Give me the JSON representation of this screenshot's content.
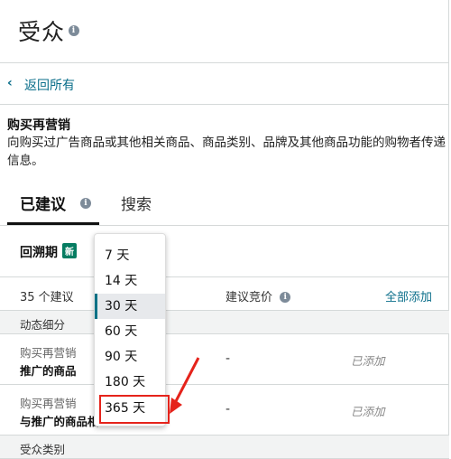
{
  "header": {
    "title": "受众"
  },
  "back_link": {
    "label": "返回所有"
  },
  "description": {
    "title": "购买再营销",
    "body": "向购买过广告商品或其他相关商品、商品类别、品牌及其他商品功能的购物者传递信息。"
  },
  "tabs": [
    {
      "label": "已建议",
      "active": true
    },
    {
      "label": "搜索",
      "active": false
    }
  ],
  "lookback": {
    "label": "回溯期",
    "badge": "新"
  },
  "table": {
    "count_label": "35 个建议",
    "bid_label": "建议竞价",
    "add_all_label": "全部添加",
    "sections": [
      {
        "label": "动态细分"
      },
      {
        "label": "受众类别"
      }
    ],
    "rows": [
      {
        "line1": "购买再营销",
        "line2": "推广的商品",
        "bid": "-",
        "status": "已添加"
      },
      {
        "line1": "购买再营销",
        "line2": "与推广的商品相",
        "bid": "-",
        "status": "已添加"
      }
    ]
  },
  "dropdown": {
    "options": [
      "7 天",
      "14 天",
      "30 天",
      "60 天",
      "90 天",
      "180 天",
      "365 天"
    ],
    "selected": "30 天",
    "highlighted": "365 天"
  },
  "colors": {
    "link": "#0a6e8a",
    "badge": "#067d62",
    "highlight": "#e5231b"
  }
}
